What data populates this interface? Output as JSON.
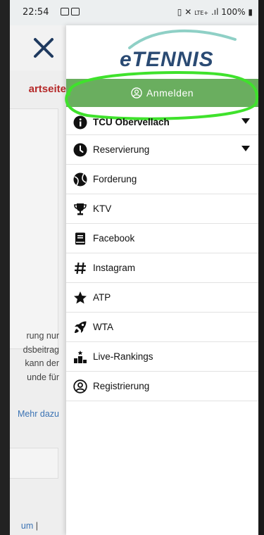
{
  "status_bar": {
    "time": "22:54",
    "network": "LTE+",
    "battery": "100%"
  },
  "background_page": {
    "heading_fragment": "artseite",
    "text_lines": [
      "rung nur",
      "dsbeitrag",
      "kann der",
      "unde für"
    ],
    "more_link": "Mehr dazu",
    "footer_fragment": "um",
    "footer_separator": "|"
  },
  "drawer": {
    "logo_text": "eTENNIS",
    "login_label": "Anmelden",
    "menu": [
      {
        "label": "TCU Obervellach",
        "icon": "info-icon",
        "has_submenu": true
      },
      {
        "label": "Reservierung",
        "icon": "clock-icon",
        "has_submenu": true
      },
      {
        "label": "Forderung",
        "icon": "tennis-ball-icon",
        "has_submenu": false
      },
      {
        "label": "KTV",
        "icon": "trophy-icon",
        "has_submenu": false
      },
      {
        "label": "Facebook",
        "icon": "book-icon",
        "has_submenu": false
      },
      {
        "label": "Instagram",
        "icon": "hashtag-icon",
        "has_submenu": false
      },
      {
        "label": "ATP",
        "icon": "star-icon",
        "has_submenu": false
      },
      {
        "label": "WTA",
        "icon": "rocket-icon",
        "has_submenu": false
      },
      {
        "label": "Live-Rankings",
        "icon": "podium-icon",
        "has_submenu": false
      },
      {
        "label": "Registrierung",
        "icon": "user-circle-icon",
        "has_submenu": false
      }
    ]
  },
  "colors": {
    "login_green": "#6aae5f",
    "highlight_green": "#3fe22c",
    "heading_red": "#b52a2a",
    "link_blue": "#3b73b4",
    "close_blue": "#1f3a5f"
  }
}
